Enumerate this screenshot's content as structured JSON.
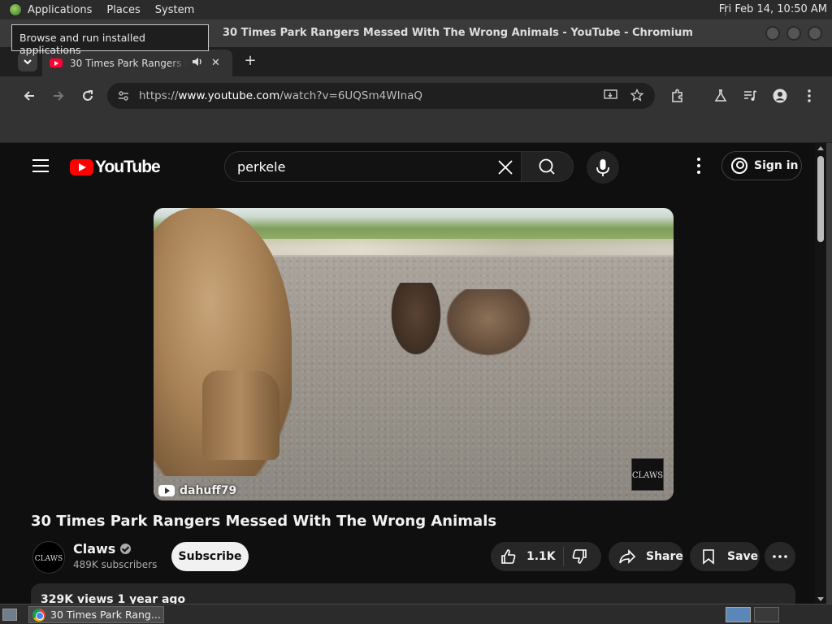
{
  "panel": {
    "menus": [
      "Applications",
      "Places",
      "System"
    ],
    "clock": "Fri Feb 14, 10:50 AM"
  },
  "tooltip": "Browse and run installed applications",
  "window": {
    "title": "30 Times Park Rangers Messed With The Wrong Animals - YouTube - Chromium"
  },
  "tabs": [
    {
      "title": "30 Times Park Rangers Messed With The Wrong Animals - YouTube",
      "audio": true
    }
  ],
  "toolbar": {
    "url_scheme": "https://",
    "url_host": "www.youtube.com",
    "url_path": "/watch?v=6UQSm4WInaQ"
  },
  "youtube": {
    "logo_text": "YouTube",
    "search_query": "perkele",
    "signin_label": "Sign in",
    "video": {
      "title": "30 Times Park Rangers Messed With The Wrong Animals",
      "watermark": "dahuff79",
      "corner_logo": "CLAWS"
    },
    "channel": {
      "name": "Claws",
      "avatar_text": "CLAWS",
      "subscribers": "489K subscribers",
      "subscribe_label": "Subscribe"
    },
    "actions": {
      "likes": "1.1K",
      "share": "Share",
      "save": "Save"
    },
    "description_meta": "329K views  1 year ago"
  },
  "taskbar": {
    "item": "30 Times Park Rang..."
  },
  "colors": {
    "yt_red": "#ff0000",
    "page_bg": "#0f0f0f",
    "pill_bg": "#272727"
  }
}
